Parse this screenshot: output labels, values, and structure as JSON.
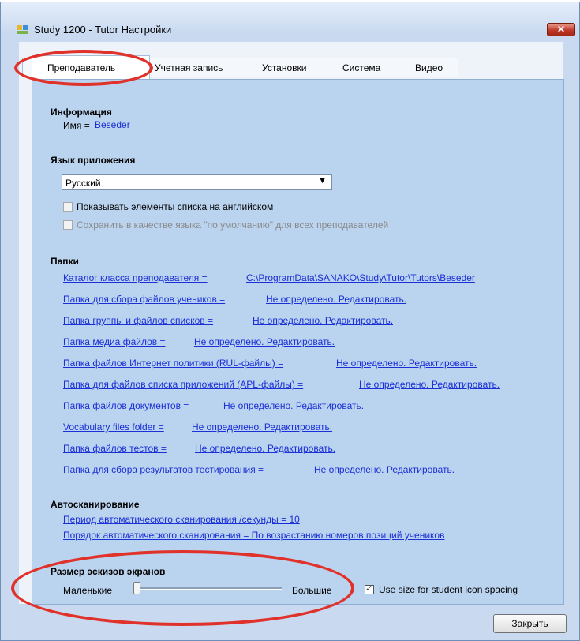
{
  "window": {
    "title": "Study 1200 - Tutor Настройки",
    "close_label": "✕"
  },
  "tabs": [
    {
      "label": "Преподаватель",
      "active": true
    },
    {
      "label": "Учетная запись",
      "active": false
    },
    {
      "label": "Установки",
      "active": false
    },
    {
      "label": "Система",
      "active": false
    },
    {
      "label": "Видео",
      "active": false
    }
  ],
  "info": {
    "heading": "Информация",
    "name_label": "Имя =",
    "name_value": "Beseder"
  },
  "language": {
    "heading": "Язык приложения",
    "selected": "Русский",
    "show_english": {
      "label": "Показывать элементы списка на английском",
      "checked": false
    },
    "save_default": {
      "label": "Сохранить в качестве языка \"по умолчанию\" для всех преподавателей",
      "checked": false,
      "disabled": true
    }
  },
  "folders": {
    "heading": "Папки",
    "items": [
      {
        "label": "Каталог класса преподавателя =",
        "value": "C:\\ProgramData\\SANAKO\\Study\\Tutor\\Tutors\\Beseder"
      },
      {
        "label": "Папка для сбора файлов учеников =",
        "value": "Не определено. Редактировать."
      },
      {
        "label": "Папка группы и файлов списков =",
        "value": "Не определено. Редактировать."
      },
      {
        "label": "Папка медиа файлов =",
        "value": "Не определено. Редактировать."
      },
      {
        "label": "Папка файлов Интернет политики (RUL-файлы) =",
        "value": "Не определено. Редактировать."
      },
      {
        "label": "Папка для файлов списка приложений (APL-файлы) =",
        "value": "Не определено. Редактировать."
      },
      {
        "label": "Папка файлов документов =",
        "value": "Не определено. Редактировать."
      },
      {
        "label": "Vocabulary files folder =",
        "value": "Не определено. Редактировать."
      },
      {
        "label": "Папка файлов тестов =",
        "value": "Не определено. Редактировать."
      },
      {
        "label": "Папка для сбора результатов тестирования =",
        "value": "Не определено. Редактировать."
      }
    ]
  },
  "autoscan": {
    "heading": "Автосканирование",
    "period": "Период автоматического сканирования /секунды = 10",
    "order": "Порядок автоматического сканирования = По возрастанию номеров позиций учеников"
  },
  "thumbnails": {
    "heading": "Размер эскизов экранов",
    "small_label": "Маленькие",
    "large_label": "Большие",
    "slider_value": 0,
    "spacing": {
      "label": "Use size for student icon spacing",
      "checked": true
    }
  },
  "footer": {
    "close_label": "Закрыть"
  },
  "colors": {
    "annotation": "#e0322a",
    "link": "#1a2fd6",
    "panel": "#bad3ee"
  }
}
